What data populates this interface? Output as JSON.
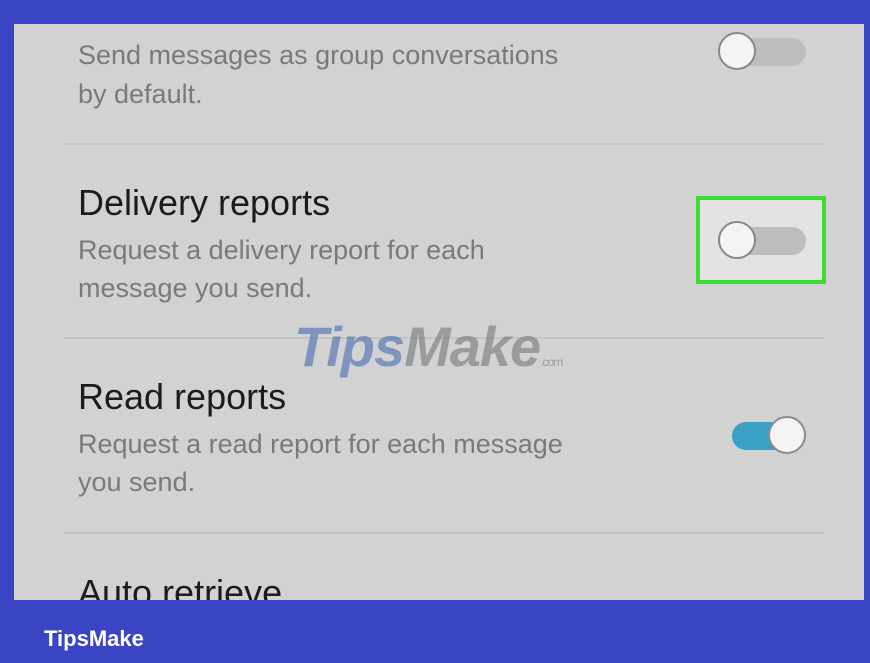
{
  "settings": {
    "group_conversation": {
      "title": "",
      "description_line1": "Send messages as group conversations",
      "description_line2": "by default.",
      "enabled": false
    },
    "delivery_reports": {
      "title": "Delivery reports",
      "description_line1": "Request a delivery report for each",
      "description_line2": "message you send.",
      "enabled": false,
      "highlighted": true
    },
    "read_reports": {
      "title": "Read reports",
      "description_line1": "Request a read report for each message",
      "description_line2": "you send.",
      "enabled": true
    },
    "auto_retrieve": {
      "title": "Auto retrieve"
    }
  },
  "watermark": {
    "part1": "Tips",
    "part2": "Make",
    "part3": ".com"
  },
  "footer": {
    "brand": "TipsMake"
  },
  "colors": {
    "frame": "#3a45c4",
    "screen_background": "#d2d2d2",
    "highlight_border": "#3ddf2f",
    "toggle_on": "#3aa1c4",
    "toggle_off": "#bdbdbd"
  }
}
